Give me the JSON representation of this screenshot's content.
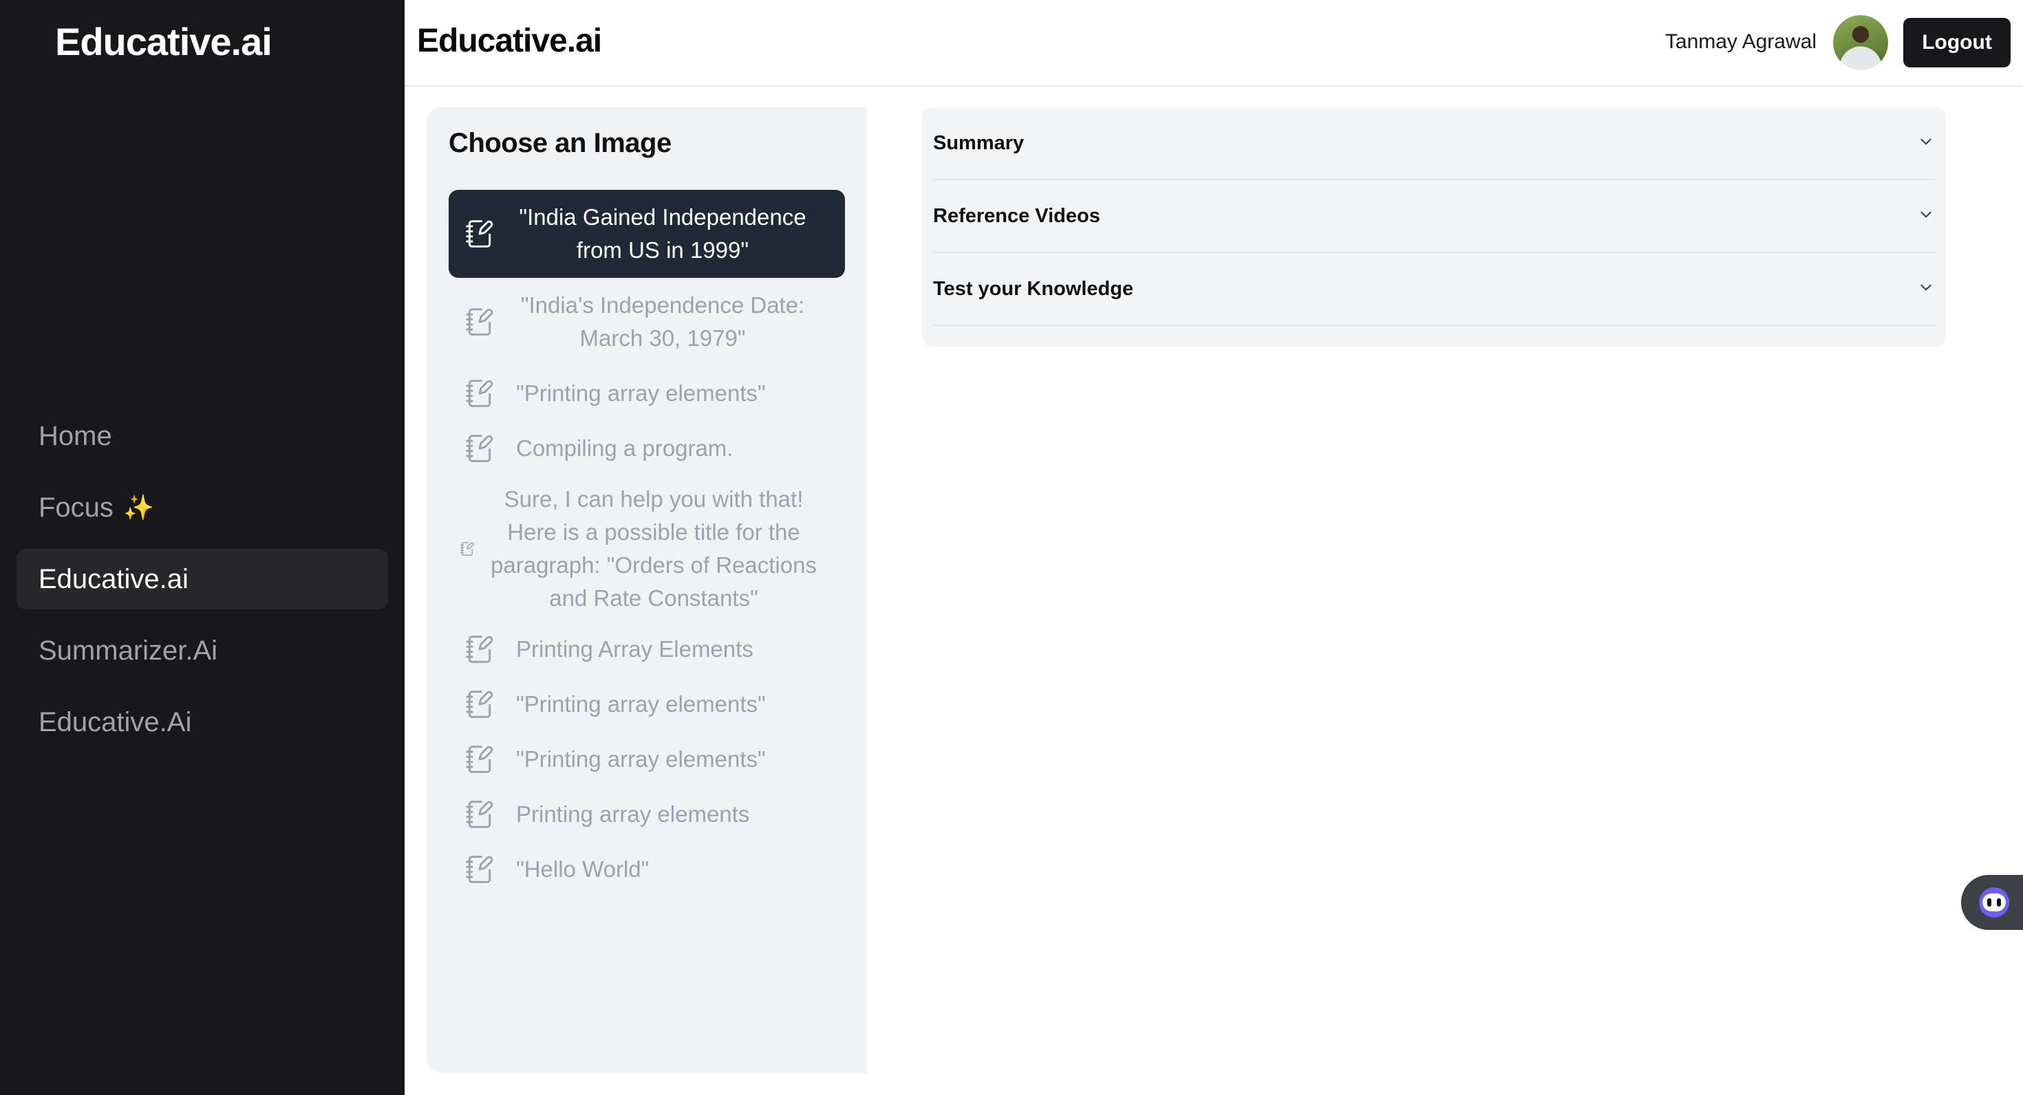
{
  "sidebar": {
    "logo": "Educative.ai",
    "nav": [
      {
        "label": "Home",
        "active": false
      },
      {
        "label": "Focus",
        "badge": "✨",
        "active": false
      },
      {
        "label": "Educative.ai",
        "active": true
      },
      {
        "label": "Summarizer.Ai",
        "active": false
      },
      {
        "label": "Educative.Ai",
        "active": false
      }
    ]
  },
  "header": {
    "title": "Educative.ai",
    "user_name": "Tanmay Agrawal",
    "logout_label": "Logout"
  },
  "chooser": {
    "heading": "Choose an Image",
    "items": [
      {
        "label": "\"India Gained Independence from US in 1999\"",
        "selected": true
      },
      {
        "label": "\"India's Independence Date: March 30, 1979\""
      },
      {
        "label": "\"Printing array elements\""
      },
      {
        "label": "Compiling a program."
      },
      {
        "label": "Sure, I can help you with that! Here is a possible title for the paragraph: \"Orders of Reactions and Rate Constants\""
      },
      {
        "label": "Printing Array Elements"
      },
      {
        "label": "\"Printing array elements\""
      },
      {
        "label": "\"Printing array elements\""
      },
      {
        "label": "Printing array elements"
      },
      {
        "label": "\"Hello World\""
      }
    ]
  },
  "accordion": {
    "sections": [
      {
        "label": "Summary"
      },
      {
        "label": "Reference Videos"
      },
      {
        "label": "Test your Knowledge"
      }
    ]
  },
  "icons": {
    "list_item": "notebook-pen-icon",
    "accordion": "chevron-down-icon",
    "chat": "chatbot-icon"
  },
  "colors": {
    "sidebar_bg": "#18181b",
    "selected_item_bg": "#1f2937",
    "panel_bg": "#f1f2f4",
    "muted_text": "#9ca3af"
  }
}
